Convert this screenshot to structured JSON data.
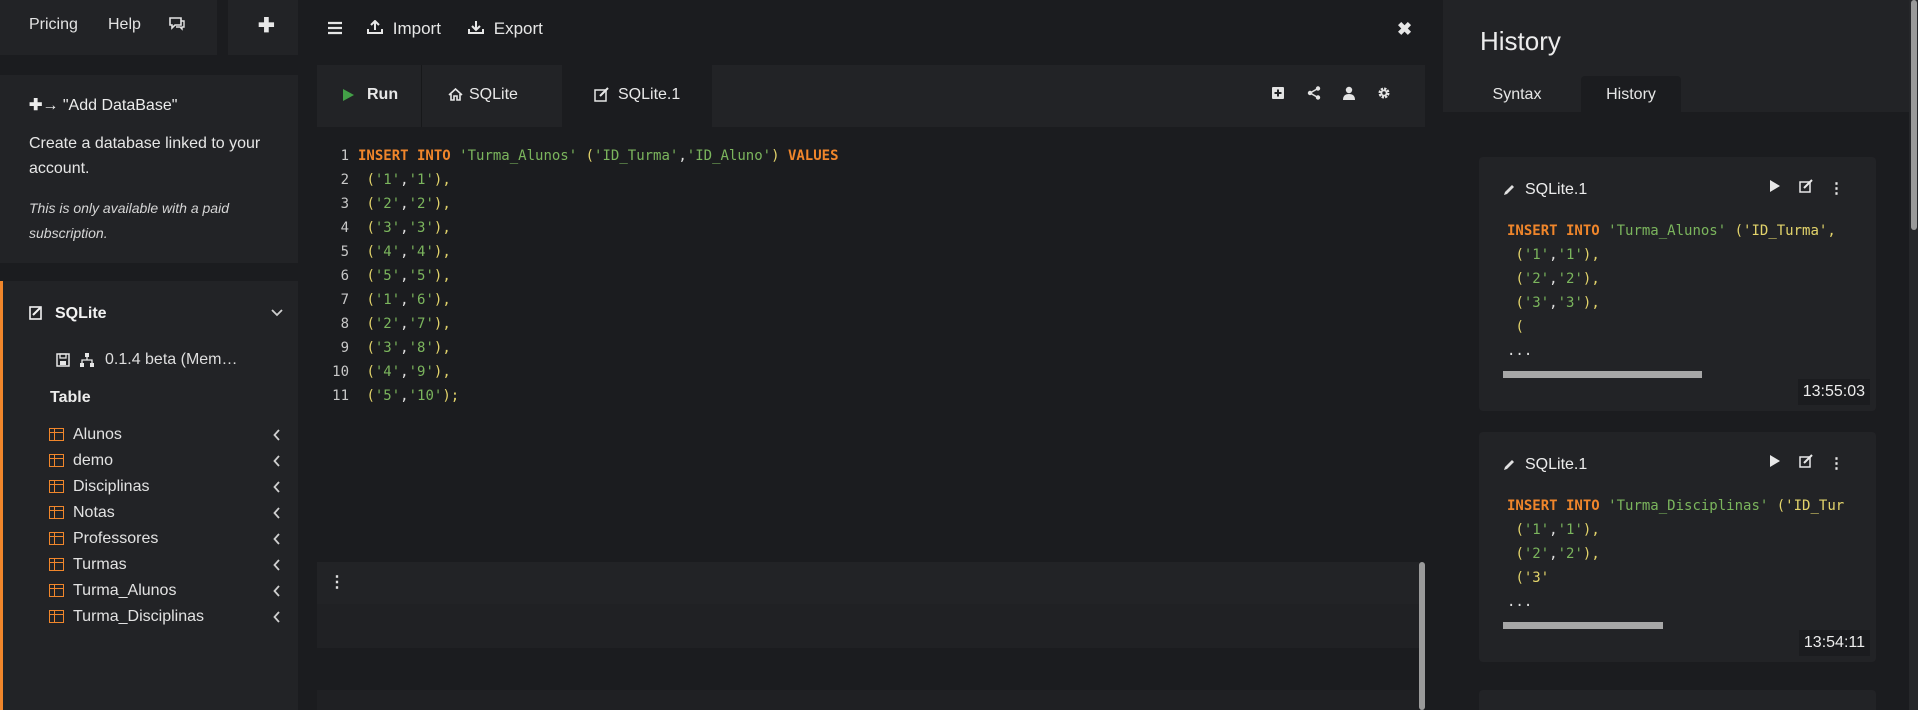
{
  "topnav": {
    "pricing": "Pricing",
    "help": "Help",
    "chat_icon": "chat-icon",
    "add_icon": "plus-icon"
  },
  "add_db": {
    "header": "\"Add DataBase\"",
    "description": "Create a database linked to your account.",
    "note": "This is only available with a paid subscription."
  },
  "database": {
    "name": "SQLite",
    "version": "0.1.4 beta (Mem…",
    "table_header": "Table",
    "tables": [
      "Alunos",
      "demo",
      "Disciplinas",
      "Notas",
      "Professores",
      "Turmas",
      "Turma_Alunos",
      "Turma_Disciplinas"
    ]
  },
  "toolbar": {
    "import": "Import",
    "export": "Export"
  },
  "tabs": {
    "run": "Run",
    "sqlite": "SQLite",
    "sqlite1": "SQLite.1"
  },
  "editor": {
    "lines": [
      {
        "n": "1",
        "kw1": "INSERT INTO",
        "s1": "'Turma_Alunos'",
        "p1": "(",
        "s2": "'ID_Turma'",
        "c": ",",
        "s3": "'ID_Aluno'",
        "p2": ")",
        "kw2": "VALUES"
      },
      {
        "n": "2",
        "a": "'1'",
        "b": "'1'",
        "end": "),"
      },
      {
        "n": "3",
        "a": "'2'",
        "b": "'2'",
        "end": "),"
      },
      {
        "n": "4",
        "a": "'3'",
        "b": "'3'",
        "end": "),"
      },
      {
        "n": "5",
        "a": "'4'",
        "b": "'4'",
        "end": "),"
      },
      {
        "n": "6",
        "a": "'5'",
        "b": "'5'",
        "end": "),"
      },
      {
        "n": "7",
        "a": "'1'",
        "b": "'6'",
        "end": "),"
      },
      {
        "n": "8",
        "a": "'2'",
        "b": "'7'",
        "end": "),"
      },
      {
        "n": "9",
        "a": "'3'",
        "b": "'8'",
        "end": "),"
      },
      {
        "n": "10",
        "a": "'4'",
        "b": "'9'",
        "end": "),"
      },
      {
        "n": "11",
        "a": "'5'",
        "b": "'10'",
        "end": ");"
      }
    ]
  },
  "history": {
    "title": "History",
    "tabs": {
      "syntax": "Syntax",
      "history": "History"
    },
    "entries": [
      {
        "db": "SQLite.1",
        "time": "13:55:03",
        "first": {
          "kw": "INSERT INTO",
          "s": "'Turma_Alunos'",
          "rest": "('ID_Turma',"
        },
        "rows": [
          [
            "'1'",
            "'1'"
          ],
          [
            "'2'",
            "'2'"
          ],
          [
            "'3'",
            "'3'"
          ]
        ],
        "tail": "(",
        "ellipsis": "...",
        "scroll_fraction": 0.73
      },
      {
        "db": "SQLite.1",
        "time": "13:54:11",
        "first": {
          "kw": "INSERT INTO",
          "s": "'Turma_Disciplinas'",
          "rest": "('ID_Tur"
        },
        "rows": [
          [
            "'1'",
            "'1'"
          ],
          [
            "'2'",
            "'2'"
          ]
        ],
        "tail": "('3'",
        "ellipsis": "...",
        "scroll_fraction": 0.59
      }
    ]
  },
  "colors": {
    "accent": "#f0862b",
    "string": "#7bb55d",
    "paren": "#e3d46b",
    "run": "#43a047"
  }
}
